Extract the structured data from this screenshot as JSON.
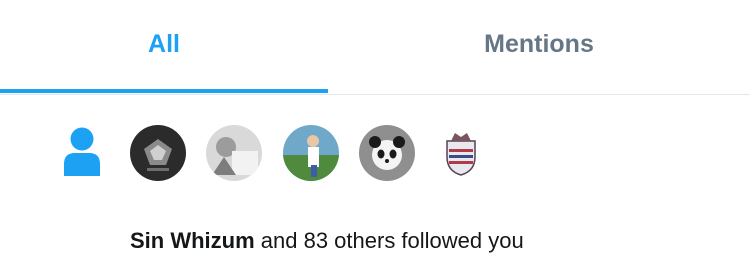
{
  "tabs": {
    "all_label": "All",
    "mentions_label": "Mentions",
    "active": "All"
  },
  "notification": {
    "type": "follow",
    "icon": "person-icon",
    "avatars": [
      "avatar-1",
      "avatar-2",
      "avatar-3",
      "avatar-4",
      "avatar-5"
    ],
    "user_name": "Sin Whizum",
    "rest_text": " and 83 others followed you"
  },
  "colors": {
    "accent": "#1da1f2",
    "inactive_tab": "#657786",
    "text": "#14171a",
    "divider": "#e1e8ed"
  }
}
